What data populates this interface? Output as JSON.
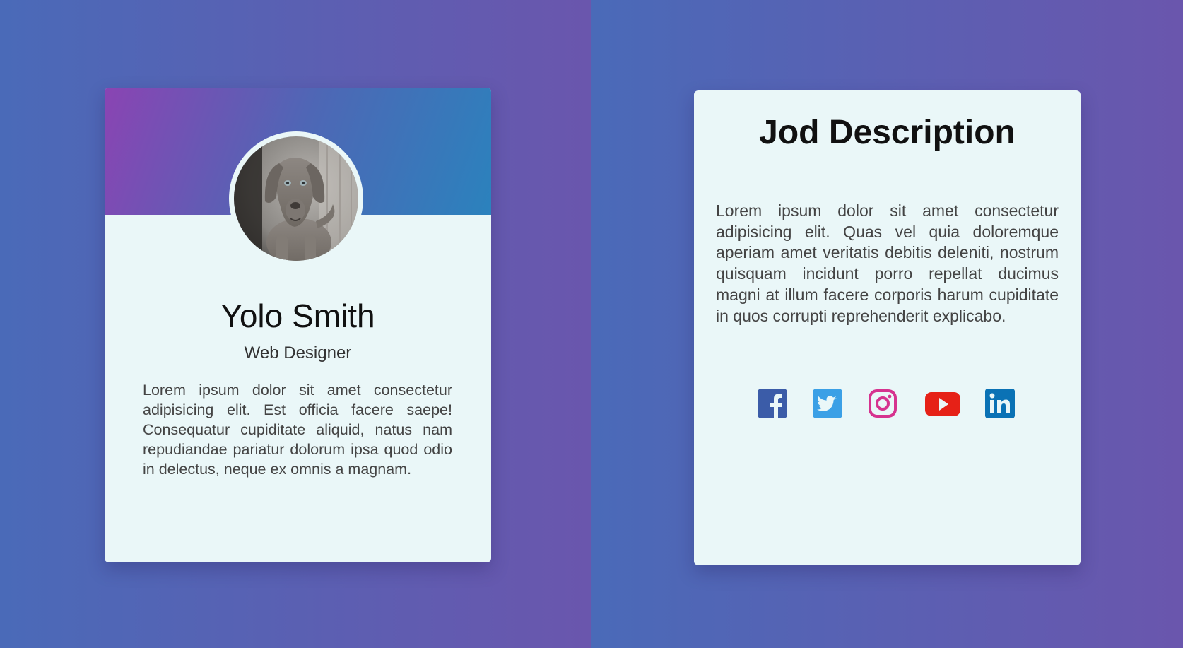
{
  "profile_card": {
    "name": "Yolo Smith",
    "role": "Web Designer",
    "bio": " Lorem ipsum dolor sit amet consectetur adipisicing elit. Est officia facere saepe! Consequatur cupiditate aliquid, natus nam repudiandae pariatur dolorum ipsa quod odio in delectus, neque ex omnis a magnam."
  },
  "job_card": {
    "title": "Jod Description",
    "description": "Lorem ipsum dolor sit amet consectetur adipisicing elit. Quas vel quia doloremque aperiam amet veritatis debitis deleniti, nostrum quisquam incidunt porro repellat ducimus magni at illum facere corporis harum cupiditate in quos corrupti reprehenderit explicabo.",
    "social_icons": [
      "facebook-icon",
      "twitter-icon",
      "instagram-icon",
      "youtube-icon",
      "linkedin-icon"
    ]
  },
  "colors": {
    "background_start": "#4a6ab8",
    "background_end": "#6a56ad",
    "card_background": "#eaf7f8",
    "banner_start": "#8a44b3",
    "banner_end": "#2b82bd",
    "facebook": "#3b5ca8",
    "twitter": "#3ba0e6",
    "instagram": "#d6338f",
    "youtube": "#e62117",
    "linkedin": "#0a72b5"
  }
}
